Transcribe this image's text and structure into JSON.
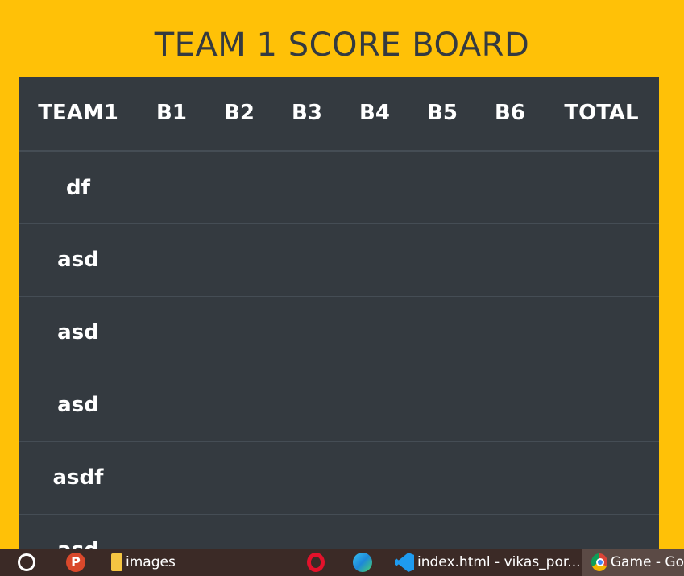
{
  "scoreboard": {
    "title": "TEAM 1 SCORE BOARD",
    "headers": [
      "TEAM1",
      "B1",
      "B2",
      "B3",
      "B4",
      "B5",
      "B6",
      "TOTAL"
    ],
    "rows": [
      {
        "name": "df"
      },
      {
        "name": "asd"
      },
      {
        "name": "asd"
      },
      {
        "name": "asd"
      },
      {
        "name": "asdf"
      },
      {
        "name": "asd"
      }
    ]
  },
  "colors": {
    "page_background": "#ffc107",
    "table_background": "#343a40",
    "title_text": "#343a40",
    "taskbar": "#3b2a26"
  },
  "taskbar": {
    "psiphon_glyph": "P",
    "explorer_label": "images",
    "vscode_label": "index.html - vikas_por...",
    "chrome_label": "Game - Go",
    "icons": [
      "cortana-icon",
      "psiphon-icon",
      "folder-icon",
      "opera-icon",
      "edge-icon",
      "vscode-icon",
      "chrome-icon"
    ]
  }
}
